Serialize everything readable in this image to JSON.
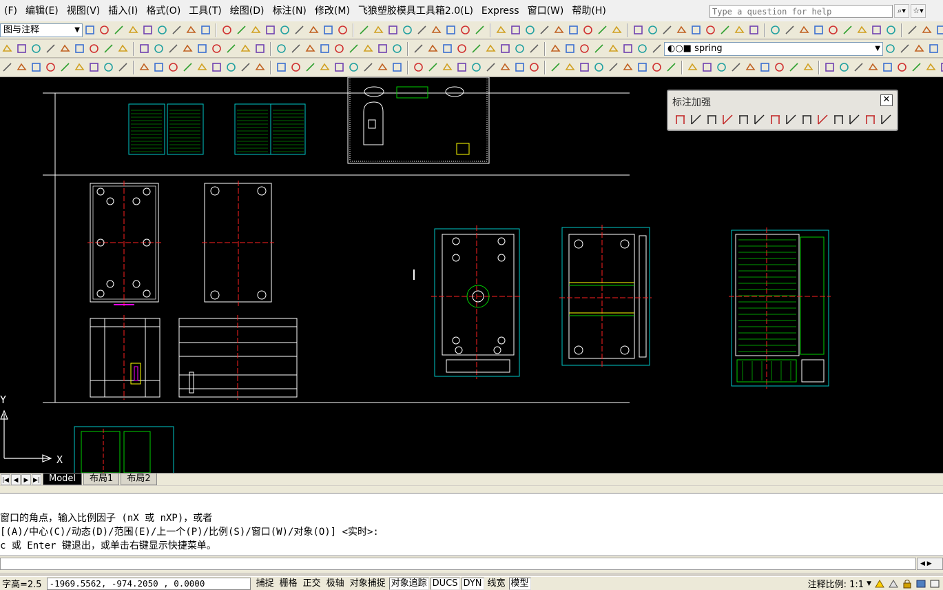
{
  "menu": [
    "(F)",
    "编辑(E)",
    "视图(V)",
    "插入(I)",
    "格式(O)",
    "工具(T)",
    "绘图(D)",
    "标注(N)",
    "修改(M)",
    "飞狼塑胶模具工具箱2.0(L)",
    "Express",
    "窗口(W)",
    "帮助(H)"
  ],
  "help_search": {
    "placeholder": "Type a question for help"
  },
  "toolbar1": {
    "workspace_value": "图与注释"
  },
  "toolbar2": {
    "layer_value": "spring"
  },
  "float_toolbar": {
    "title": "标注加强",
    "close_label": "✕"
  },
  "layout_tabs": [
    "Model",
    "布局1",
    "布局2"
  ],
  "axis": {
    "y_label": "Y",
    "x_label": "X"
  },
  "command_lines": [
    "窗口的角点，输入比例因子 (nX 或 nXP)，或者",
    "[(A)/中心(C)/动态(D)/范围(E)/上一个(P)/比例(S)/窗口(W)/对象(O)] <实时>:",
    "c 或 Enter 键退出，或单击右键显示快捷菜单。"
  ],
  "status": {
    "text_height": "字高=2.5",
    "coordinates": "-1969.5562, -974.2050 , 0.0000",
    "toggles": [
      {
        "label": "捕捉",
        "on": false
      },
      {
        "label": "栅格",
        "on": false
      },
      {
        "label": "正交",
        "on": false
      },
      {
        "label": "极轴",
        "on": false
      },
      {
        "label": "对象捕捉",
        "on": false
      },
      {
        "label": "对象追踪",
        "on": true
      },
      {
        "label": "DUCS",
        "on": true
      },
      {
        "label": "DYN",
        "on": true
      },
      {
        "label": "线宽",
        "on": false
      },
      {
        "label": "模型",
        "on": true
      }
    ],
    "annotation_scale": "注释比例: 1:1"
  },
  "colors": {
    "canvas_bg": "#000000",
    "line_white": "#ffffff",
    "line_cyan": "#00c8c8",
    "line_green": "#00d000",
    "line_red": "#ff2020",
    "line_yellow": "#ffff00",
    "line_magenta": "#ff00ff"
  }
}
